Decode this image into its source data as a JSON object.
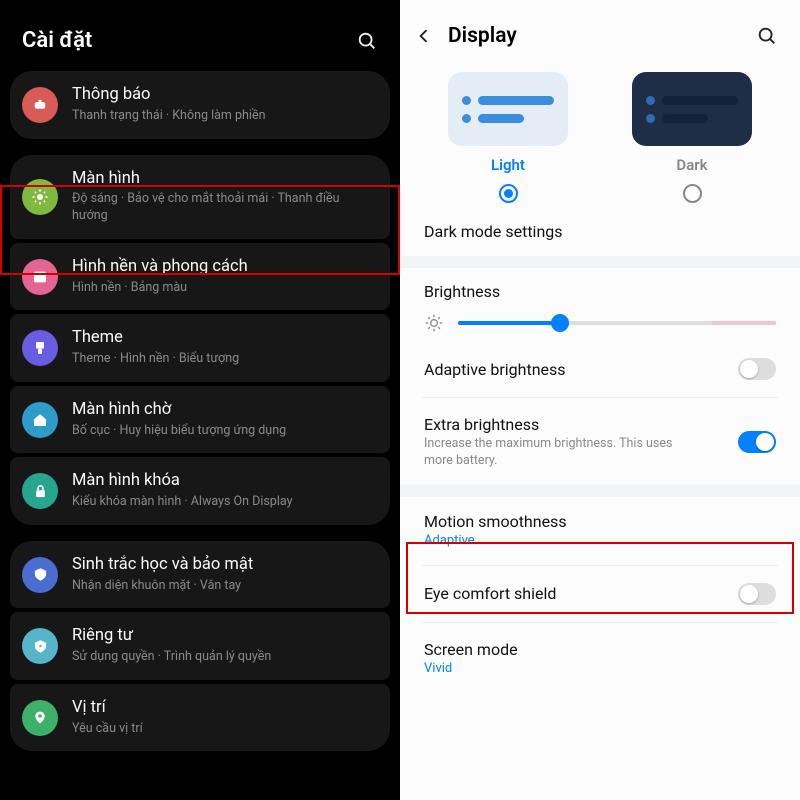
{
  "left": {
    "title": "Cài đặt",
    "items": [
      {
        "label": "Thông báo",
        "sub": "Thanh trạng thái · Không làm phiền",
        "icon": "bell",
        "color": "#d85b56"
      },
      {
        "label": "Màn hình",
        "sub": "Độ sáng · Bảo vệ cho mắt thoải mái · Thanh điều hướng",
        "icon": "sun",
        "color": "#7fb940"
      },
      {
        "label": "Hình nền và phong cách",
        "sub": "Hình nền · Bảng màu",
        "icon": "image",
        "color": "#e46494"
      },
      {
        "label": "Theme",
        "sub": "Theme · Hình nền · Biểu tượng",
        "icon": "brush",
        "color": "#6a5ce0"
      },
      {
        "label": "Màn hình chờ",
        "sub": "Bố cục · Huy hiệu biểu tượng ứng dụng",
        "icon": "home",
        "color": "#2e9cc9"
      },
      {
        "label": "Màn hình khóa",
        "sub": "Kiểu khóa màn hình · Always On Display",
        "icon": "lock",
        "color": "#27a58d"
      },
      {
        "label": "Sinh trắc học và bảo mật",
        "sub": "Nhận diện khuôn mặt · Vân tay",
        "icon": "shield",
        "color": "#4a6dd0"
      },
      {
        "label": "Riêng tư",
        "sub": "Sử dụng quyền · Trình quản lý quyền",
        "icon": "privacy",
        "color": "#57b5c9"
      },
      {
        "label": "Vị trí",
        "sub": "Yêu cầu vị trí",
        "icon": "pin",
        "color": "#3fb06a"
      }
    ]
  },
  "right": {
    "title": "Display",
    "theme": {
      "light": "Light",
      "dark": "Dark",
      "selected": "light"
    },
    "dark_mode_settings": "Dark mode settings",
    "brightness": "Brightness",
    "adaptive": "Adaptive brightness",
    "extra": {
      "label": "Extra brightness",
      "sub": "Increase the maximum brightness. This uses more battery."
    },
    "motion": {
      "label": "Motion smoothness",
      "value": "Adaptive"
    },
    "eye": "Eye comfort shield",
    "screen_mode": {
      "label": "Screen mode",
      "value": "Vivid"
    }
  }
}
